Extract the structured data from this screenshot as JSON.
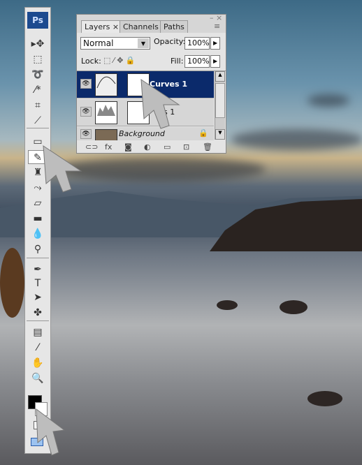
{
  "toolbar": {
    "logo": "Ps",
    "tools": [
      {
        "name": "move",
        "glyph": "▸✥"
      },
      {
        "name": "marquee",
        "glyph": "⬚"
      },
      {
        "name": "lasso",
        "glyph": "➰"
      },
      {
        "name": "magic-wand",
        "glyph": "⁄*"
      },
      {
        "name": "crop",
        "glyph": "⌗"
      },
      {
        "name": "slice",
        "glyph": "⟋"
      },
      {
        "name": "healing-brush",
        "glyph": "▭"
      },
      {
        "name": "brush",
        "glyph": "✎"
      },
      {
        "name": "clone-stamp",
        "glyph": "♜"
      },
      {
        "name": "history-brush",
        "glyph": "⤳"
      },
      {
        "name": "eraser",
        "glyph": "▱"
      },
      {
        "name": "gradient",
        "glyph": "▬"
      },
      {
        "name": "blur",
        "glyph": "💧"
      },
      {
        "name": "dodge",
        "glyph": "⚲"
      },
      {
        "name": "pen",
        "glyph": "✒"
      },
      {
        "name": "type",
        "glyph": "T"
      },
      {
        "name": "path-selection",
        "glyph": "➤"
      },
      {
        "name": "custom-shape",
        "glyph": "✤"
      },
      {
        "name": "notes",
        "glyph": "▤"
      },
      {
        "name": "eyedropper",
        "glyph": "⁄"
      },
      {
        "name": "hand",
        "glyph": "✋"
      },
      {
        "name": "zoom",
        "glyph": "🔍"
      }
    ]
  },
  "layers_panel": {
    "tabs": [
      "Layers ×",
      "Channels",
      "Paths"
    ],
    "blend_mode": "Normal",
    "opacity_label": "Opacity:",
    "opacity": "100%",
    "lock_label": "Lock:",
    "fill_label": "Fill:",
    "fill": "100%",
    "layers": [
      {
        "name": "Curves 1",
        "selected": true
      },
      {
        "name": "s 1",
        "selected": false
      },
      {
        "name": "Background",
        "selected": false
      }
    ],
    "footer": [
      "⊂⊃",
      "fx",
      "◙",
      "◐",
      "▭",
      "⊡",
      "🗑"
    ]
  }
}
